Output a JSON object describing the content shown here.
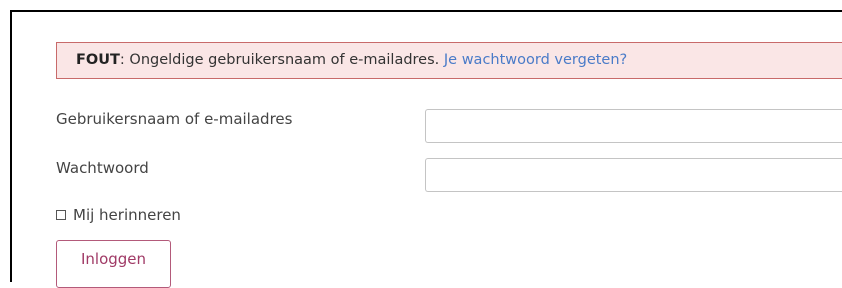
{
  "error": {
    "prefix": "FOUT",
    "message": ": Ongeldige gebruikersnaam of e-mailadres. ",
    "link": "Je wachtwoord vergeten?"
  },
  "form": {
    "username_label": "Gebruikersnaam of e-mailadres",
    "username_value": "",
    "password_label": "Wachtwoord",
    "password_value": "",
    "remember_label": "Mij herinneren",
    "remember_checked": false,
    "submit_label": "Inloggen"
  },
  "colors": {
    "error_bg": "#fae6e6",
    "error_border": "#c86a6a",
    "link": "#4a7bc8",
    "button_text": "#a03a66",
    "button_border": "#b35a7a"
  }
}
